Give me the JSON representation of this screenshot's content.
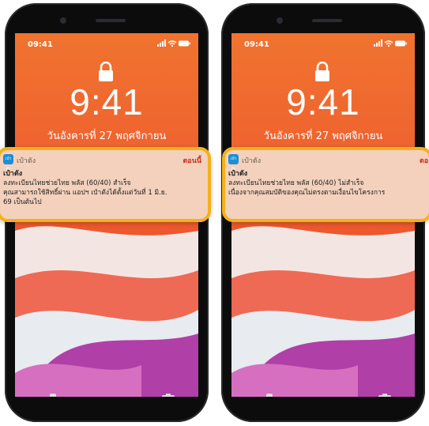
{
  "phones": [
    {
      "status_time": "09:41",
      "clock": "9:41",
      "date": "วันอังคารที่ 27 พฤศจิกายน",
      "notification": {
        "app_icon_text": "เป๋าตัง",
        "app_name": "เป๋าตัง",
        "time": "ตอนนี้",
        "title": "เป๋าตัง",
        "body_lines": [
          "ลงทะเบียนไทยช่วยไทย พลัส (60/40) สำเร็จ",
          "คุณสามารถใช้สิทธิ์ผ่าน แอปฯ เป๋าตังได้ตั้งแต่วันที่ 1 มิ.ย.",
          "69 เป็นต้นไป"
        ]
      }
    },
    {
      "status_time": "09:41",
      "clock": "9:41",
      "date": "วันอังคารที่ 27 พฤศจิกายน",
      "notification": {
        "app_icon_text": "เป๋าตัง",
        "app_name": "เป๋าตัง",
        "time": "ตอ",
        "title": "เป๋าตัง",
        "body_lines": [
          "ลงทะเบียนไทยช่วยไทย พลัส (60/40) ไม่สำเร็จ",
          "เนื่องจากคุณสมบัติของคุณไม่ตรงตามเงื่อนไขโครงการ"
        ]
      }
    }
  ],
  "colors": {
    "wallpaper_orange": "#ec6a33",
    "highlight_border": "#f5b01a",
    "notification_bg": "#f3d1bc",
    "notification_time": "#c7301e"
  },
  "icons": [
    "lock-icon",
    "signal-icon",
    "wifi-icon",
    "battery-icon",
    "flashlight-icon",
    "camera-icon"
  ]
}
